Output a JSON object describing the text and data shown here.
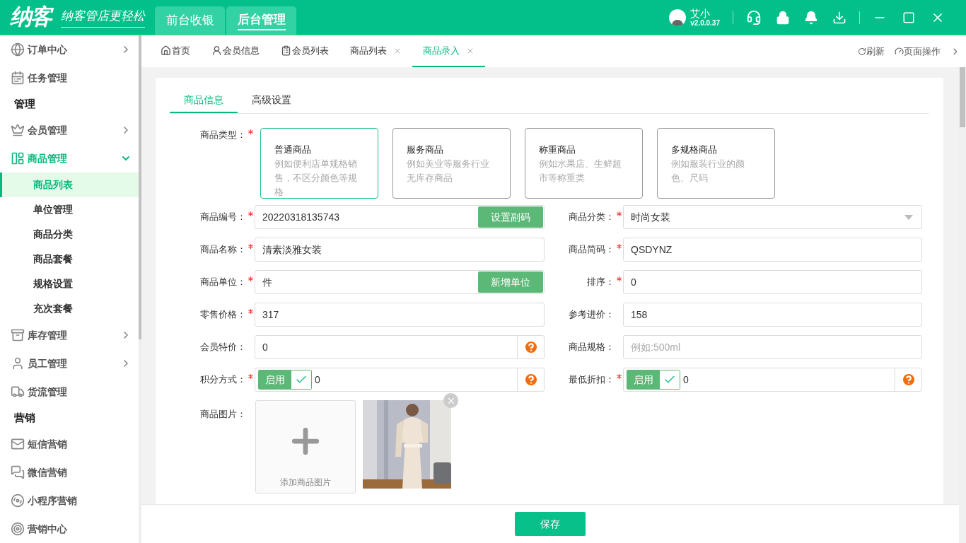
{
  "header": {
    "logo": "纳客",
    "slogan": "纳客管店更轻松",
    "modes": [
      {
        "label": "前台收银",
        "selected": false
      },
      {
        "label": "后台管理",
        "selected": true
      }
    ],
    "user": {
      "name": "艾小",
      "version": "v2.0.0.37"
    }
  },
  "sidebar": {
    "items": [
      {
        "kind": "item",
        "label": "订单中心",
        "expandable": true,
        "expanded": false
      },
      {
        "kind": "item",
        "label": "任务管理",
        "expandable": false,
        "expanded": false
      },
      {
        "kind": "section",
        "label": "管理"
      },
      {
        "kind": "item",
        "label": "会员管理",
        "expandable": true,
        "expanded": false
      },
      {
        "kind": "item",
        "label": "商品管理",
        "expandable": true,
        "expanded": true,
        "children": [
          {
            "label": "商品列表",
            "selected": true
          },
          {
            "label": "单位管理",
            "selected": false
          },
          {
            "label": "商品分类",
            "selected": false
          },
          {
            "label": "商品套餐",
            "selected": false
          },
          {
            "label": "规格设置",
            "selected": false
          },
          {
            "label": "充次套餐",
            "selected": false
          }
        ]
      },
      {
        "kind": "item",
        "label": "库存管理",
        "expandable": true,
        "expanded": false
      },
      {
        "kind": "item",
        "label": "员工管理",
        "expandable": true,
        "expanded": false
      },
      {
        "kind": "item",
        "label": "货流管理",
        "expandable": false,
        "expanded": false
      },
      {
        "kind": "section",
        "label": "营销"
      },
      {
        "kind": "item",
        "label": "短信营销",
        "expandable": false,
        "expanded": false
      },
      {
        "kind": "item",
        "label": "微信营销",
        "expandable": false,
        "expanded": false
      },
      {
        "kind": "item",
        "label": "小程序营销",
        "expandable": false,
        "expanded": false
      },
      {
        "kind": "item",
        "label": "营销中心",
        "expandable": false,
        "expanded": false
      }
    ]
  },
  "page_tabs": {
    "tabs": [
      {
        "label": "首页",
        "selected": false,
        "closable": false
      },
      {
        "label": "会员信息",
        "selected": false,
        "closable": false
      },
      {
        "label": "会员列表",
        "selected": false,
        "closable": false
      },
      {
        "label": "商品列表",
        "selected": false,
        "closable": true
      },
      {
        "label": "商品录入",
        "selected": true,
        "closable": true
      }
    ],
    "actions": [
      "刷新",
      "页面操作"
    ]
  },
  "form": {
    "tabs": [
      {
        "label": "商品信息",
        "selected": true
      },
      {
        "label": "高级设置",
        "selected": false
      }
    ],
    "type_label": "商品类型：",
    "type_required": true,
    "types": [
      {
        "title": "普通商品",
        "desc": "例如便利店单规格销售，不区分颜色等规格",
        "selected": true
      },
      {
        "title": "服务商品",
        "desc": "例如美业等服务行业无库存商品",
        "selected": false
      },
      {
        "title": "称重商品",
        "desc": "例如水果店、生鲜超市等称重类",
        "selected": false
      },
      {
        "title": "多规格商品",
        "desc": "例如服装行业的颜色、尺码",
        "selected": false
      }
    ],
    "rows": [
      [
        {
          "label": "商品编号：",
          "required": true,
          "kind": "button-input",
          "value": "20220318135743",
          "button": "设置副码"
        },
        {
          "label": "商品分类：",
          "required": true,
          "kind": "select",
          "value": "时尚女装"
        }
      ],
      [
        {
          "label": "商品名称：",
          "required": true,
          "kind": "text",
          "value": "清素淡雅女装"
        },
        {
          "label": "商品简码：",
          "required": true,
          "kind": "text",
          "value": "QSDYNZ"
        }
      ],
      [
        {
          "label": "商品单位：",
          "required": true,
          "kind": "button-input",
          "value": "件",
          "button": "新增单位"
        },
        {
          "label": "排序：",
          "required": true,
          "kind": "text",
          "value": "0"
        }
      ],
      [
        {
          "label": "零售价格：",
          "required": true,
          "kind": "text",
          "value": "317"
        },
        {
          "label": "参考进价：",
          "required": false,
          "kind": "text",
          "value": "158"
        }
      ],
      [
        {
          "label": "会员特价：",
          "required": false,
          "kind": "help",
          "value": "0"
        },
        {
          "label": "商品规格：",
          "required": false,
          "kind": "text",
          "placeholder": "例如:500ml"
        }
      ],
      [
        {
          "label": "积分方式：",
          "required": true,
          "kind": "toggle",
          "toggle": "启用",
          "on": true,
          "value": "0"
        },
        {
          "label": "最低折扣：",
          "required": true,
          "kind": "toggle",
          "toggle": "启用",
          "on": true,
          "value": "0"
        }
      ]
    ],
    "images": {
      "label": "商品图片：",
      "add": "添加商品图片"
    },
    "save": "保存"
  }
}
